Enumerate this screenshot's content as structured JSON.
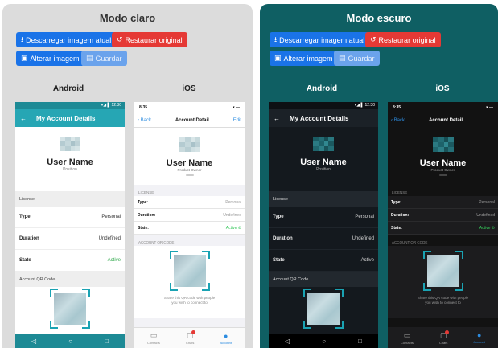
{
  "light": {
    "title": "Modo claro",
    "buttons": {
      "download": "Descarregar imagem atual",
      "restore": "Restaurar original",
      "change": "Alterar imagem",
      "save": "Guardar"
    },
    "android_label": "Android",
    "ios_label": "iOS"
  },
  "dark": {
    "title": "Modo escuro",
    "buttons": {
      "download": "Descarregar imagem atual",
      "restore": "Restaurar original",
      "change": "Alterar imagem",
      "save": "Guardar"
    },
    "android_label": "Android",
    "ios_label": "iOS"
  },
  "android": {
    "statusbar": "▾◢ ▌ 12:30",
    "appbar_title": "My Account Details",
    "user_name": "User Name",
    "position": "Position",
    "section_license": "License",
    "rows": [
      {
        "label": "Type",
        "value": "Personal"
      },
      {
        "label": "Duration",
        "value": "Undefined"
      },
      {
        "label": "State",
        "value": "Active"
      }
    ],
    "section_qr": "Account QR Code",
    "nav": [
      "◁",
      "○",
      "□"
    ]
  },
  "ios": {
    "time": "8:35",
    "signal": "…▾ ▬",
    "back": "Back",
    "nav_title": "Account Detail",
    "edit": "Edit",
    "user_name": "User Name",
    "position": "Product Owner",
    "section_license": "LICENSE",
    "rows": [
      {
        "label": "Type:",
        "value": "Personal"
      },
      {
        "label": "Duration:",
        "value": "Undefined"
      },
      {
        "label": "State:",
        "value": "Active"
      }
    ],
    "section_qr": "ACCOUNT QR CODE",
    "share_text": [
      "Share this QR code with people",
      "you wish to connect to"
    ],
    "tabs": [
      {
        "label": "Contacts",
        "icon": "contacts-icon"
      },
      {
        "label": "Chats",
        "icon": "chats-icon"
      },
      {
        "label": "Account",
        "icon": "account-icon"
      }
    ]
  },
  "colors": {
    "primary": "#1a73e8",
    "danger": "#e53935",
    "teal": "#26a6b4",
    "dark_bg": "#0f5f63"
  }
}
